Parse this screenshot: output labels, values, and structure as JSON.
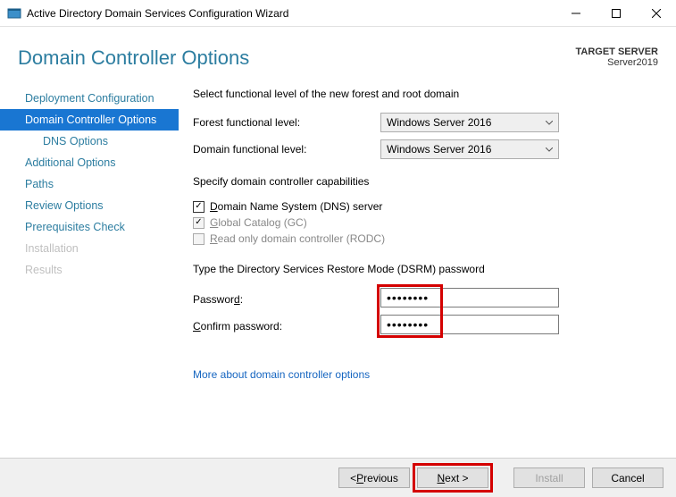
{
  "window": {
    "title": "Active Directory Domain Services Configuration Wizard"
  },
  "header": {
    "page_title": "Domain Controller Options",
    "target_label": "TARGET SERVER",
    "target_value": "Server2019"
  },
  "sidebar": {
    "items": [
      {
        "label": "Deployment Configuration",
        "state": "normal"
      },
      {
        "label": "Domain Controller Options",
        "state": "selected"
      },
      {
        "label": "DNS Options",
        "state": "sub"
      },
      {
        "label": "Additional Options",
        "state": "normal"
      },
      {
        "label": "Paths",
        "state": "normal"
      },
      {
        "label": "Review Options",
        "state": "normal"
      },
      {
        "label": "Prerequisites Check",
        "state": "normal"
      },
      {
        "label": "Installation",
        "state": "disabled"
      },
      {
        "label": "Results",
        "state": "disabled"
      }
    ]
  },
  "main": {
    "func_level_text": "Select functional level of the new forest and root domain",
    "forest_label": "Forest functional level:",
    "forest_value": "Windows Server 2016",
    "domain_label": "Domain functional level:",
    "domain_value": "Windows Server 2016",
    "capabilities_text": "Specify domain controller capabilities",
    "dns_label": "Domain Name System (DNS) server",
    "gc_label": "Global Catalog (GC)",
    "rodc_label": "Read only domain controller (RODC)",
    "dsrm_text": "Type the Directory Services Restore Mode (DSRM) password",
    "password_label": "Password:",
    "password_value": "••••••••",
    "confirm_label": "Confirm password:",
    "confirm_value": "••••••••",
    "link_text": "More about domain controller options"
  },
  "footer": {
    "previous": "< Previous",
    "next": "Next >",
    "install": "Install",
    "cancel": "Cancel"
  }
}
